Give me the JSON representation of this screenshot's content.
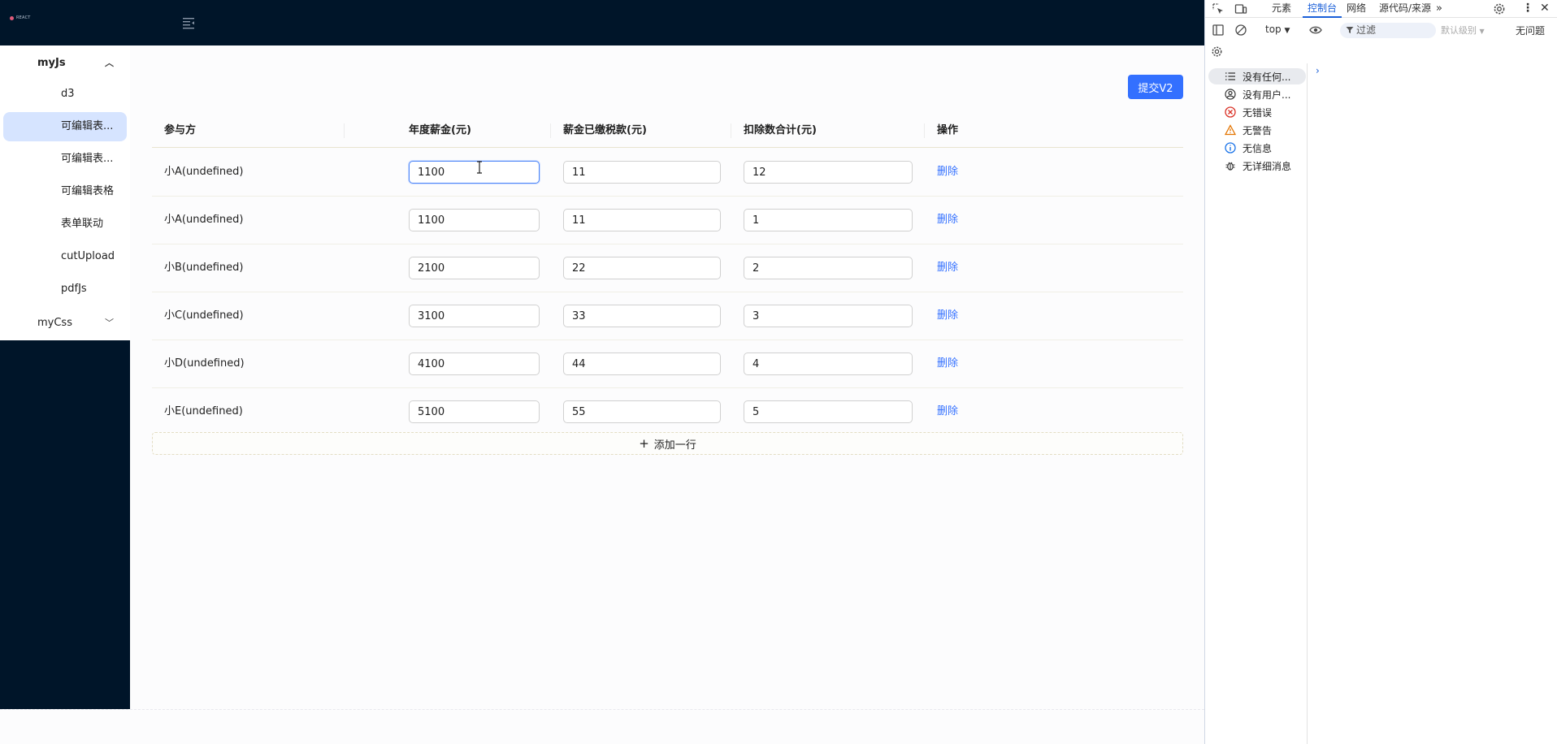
{
  "header": {
    "logo_text": "REACT"
  },
  "sidebar": {
    "groups": [
      {
        "label": "myJs",
        "expanded": true
      },
      {
        "label": "myCss",
        "expanded": false
      }
    ],
    "items": [
      "d3",
      "可编辑表...",
      "可编辑表...",
      "可编辑表格",
      "表单联动",
      "cutUpload",
      "pdfJs"
    ],
    "active_index": 1
  },
  "toolbar": {
    "submit_label": "提交V2"
  },
  "table": {
    "columns": [
      "参与方",
      "年度薪金(元)",
      "薪金已缴税款(元)",
      "扣除数合计(元)",
      "操作"
    ],
    "rows": [
      {
        "name": "小A(undefined)",
        "salary": "1100",
        "tax": "11",
        "deduction": "12"
      },
      {
        "name": "小A(undefined)",
        "salary": "1100",
        "tax": "11",
        "deduction": "1"
      },
      {
        "name": "小B(undefined)",
        "salary": "2100",
        "tax": "22",
        "deduction": "2"
      },
      {
        "name": "小C(undefined)",
        "salary": "3100",
        "tax": "33",
        "deduction": "3"
      },
      {
        "name": "小D(undefined)",
        "salary": "4100",
        "tax": "44",
        "deduction": "4"
      },
      {
        "name": "小E(undefined)",
        "salary": "5100",
        "tax": "55",
        "deduction": "5"
      }
    ],
    "delete_label": "删除",
    "add_row_label": "添加一行"
  },
  "devtools": {
    "tabs": [
      "元素",
      "控制台",
      "网络",
      "源代码/来源"
    ],
    "active_tab": "控制台",
    "context": "top",
    "filter_placeholder": "过滤",
    "level": "默认级别",
    "issues": "无问题",
    "sidebar": [
      {
        "icon": "list-icon",
        "label": "没有任何..."
      },
      {
        "icon": "user-icon",
        "label": "没有用户..."
      },
      {
        "icon": "error-icon",
        "label": "无错误"
      },
      {
        "icon": "warning-icon",
        "label": "无警告"
      },
      {
        "icon": "info-icon",
        "label": "无信息"
      },
      {
        "icon": "bug-icon",
        "label": "无详细消息"
      }
    ],
    "colors": {
      "accent": "#1a5fd8",
      "error": "#d93025",
      "warning": "#e37400",
      "info": "#1a73e8"
    }
  },
  "colors": {
    "primary": "#3370ff",
    "nav_bg": "#001529",
    "menu_active_bg": "#d6e4ff"
  }
}
